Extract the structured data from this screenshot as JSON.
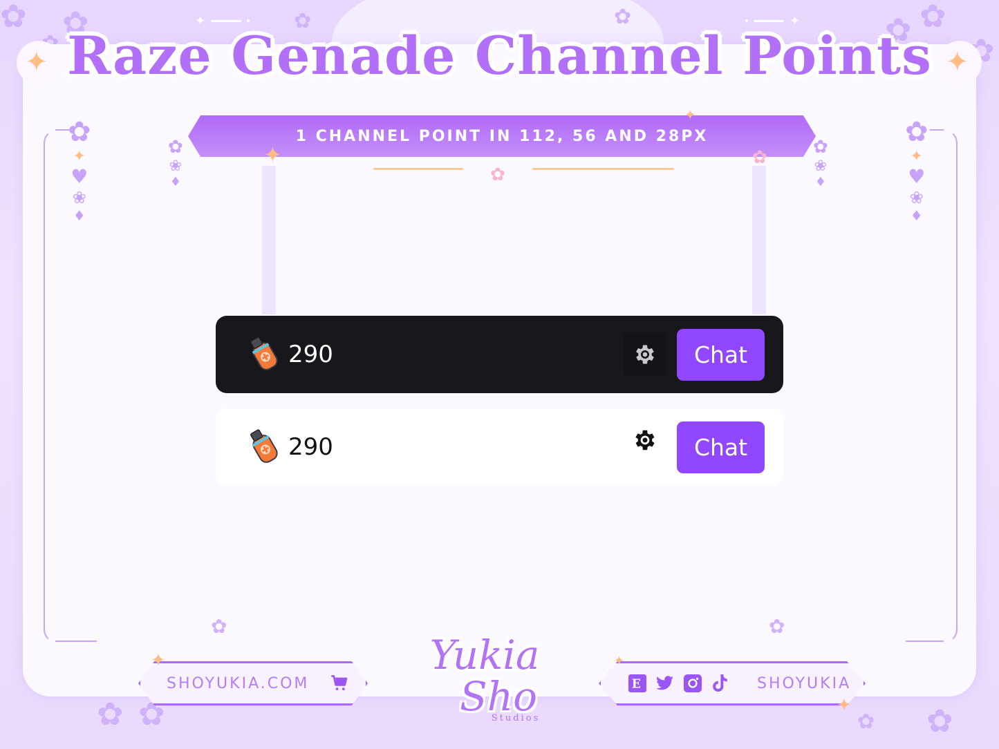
{
  "page": {
    "title": "Raze Genade Channel Points",
    "subtitle": "1 CHANNEL POINT IN 112, 56 AND 28PX"
  },
  "colors": {
    "accent_purple": "#9147ff",
    "title_purple": "#b26ff8",
    "sparkle_orange": "#ffbd84",
    "dark_panel": "#18171c",
    "light_panel": "#ffffff"
  },
  "previews": [
    {
      "theme": "dark",
      "icon": "grenade-icon",
      "points": "290",
      "settings_icon": "gear-icon",
      "button_label": "Chat"
    },
    {
      "theme": "light",
      "icon": "grenade-icon",
      "points": "290",
      "settings_icon": "gear-icon",
      "button_label": "Chat"
    }
  ],
  "footer": {
    "website": "SHOYUKIA.COM",
    "website_icon": "cart-icon",
    "handle": "SHOYUKIA",
    "socials": [
      "etsy-icon",
      "twitter-icon",
      "instagram-icon",
      "tiktok-icon"
    ],
    "logo_main_line1": "Yukia",
    "logo_main_line2": "Sho",
    "logo_sub": "Studios"
  }
}
